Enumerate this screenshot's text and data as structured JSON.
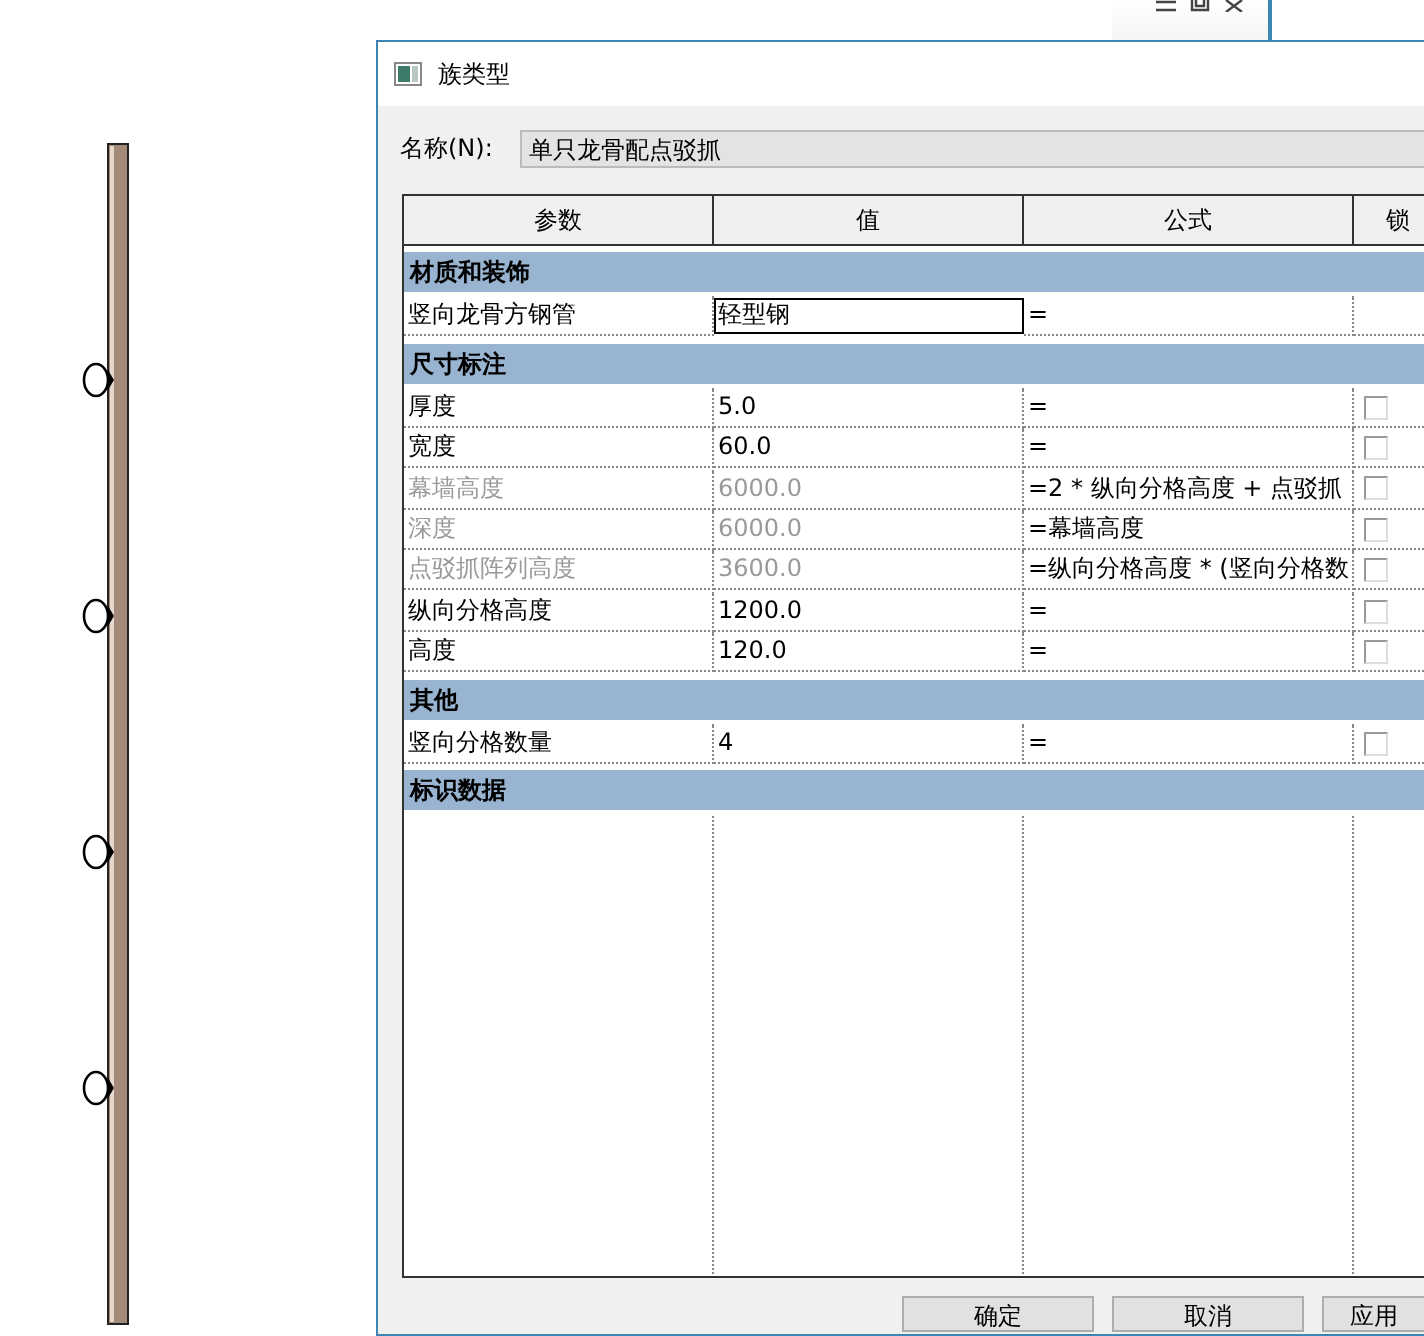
{
  "dialog": {
    "title": "族类型",
    "name_label": "名称(N):",
    "name_value": "单只龙骨配点驳抓"
  },
  "table": {
    "columns": [
      "参数",
      "值",
      "公式",
      "锁"
    ],
    "rows": [
      {
        "kind": "group",
        "label": "材质和装饰"
      },
      {
        "kind": "param",
        "label": "竖向龙骨方钢管",
        "value": "轻型钢",
        "formula": "=",
        "disabled": false,
        "focused": true
      },
      {
        "kind": "group",
        "label": "尺寸标注"
      },
      {
        "kind": "param",
        "label": "厚度",
        "value": "5.0",
        "formula": "=",
        "disabled": false,
        "focused": false,
        "lock": {
          "checked": false
        }
      },
      {
        "kind": "param",
        "label": "宽度",
        "value": "60.0",
        "formula": "=",
        "disabled": false,
        "focused": false,
        "lock": {
          "checked": false
        }
      },
      {
        "kind": "param",
        "label": "幕墙高度",
        "value": "6000.0",
        "formula": "=2 * 纵向分格高度 + 点驳抓",
        "disabled": true,
        "focused": false,
        "lock": {
          "checked": false
        }
      },
      {
        "kind": "param",
        "label": "深度",
        "value": "6000.0",
        "formula": "=幕墙高度",
        "disabled": true,
        "focused": false,
        "lock": {
          "checked": false
        }
      },
      {
        "kind": "param",
        "label": "点驳抓阵列高度",
        "value": "3600.0",
        "formula": "=纵向分格高度 * (竖向分格数",
        "disabled": true,
        "focused": false,
        "lock": {
          "checked": false
        }
      },
      {
        "kind": "param",
        "label": "纵向分格高度",
        "value": "1200.0",
        "formula": "=",
        "disabled": false,
        "focused": false,
        "lock": {
          "checked": false
        }
      },
      {
        "kind": "param",
        "label": "高度",
        "value": "120.0",
        "formula": "=",
        "disabled": false,
        "focused": false,
        "lock": {
          "checked": false
        }
      },
      {
        "kind": "group",
        "label": "其他"
      },
      {
        "kind": "param",
        "label": "竖向分格数量",
        "value": "4",
        "formula": "=",
        "disabled": false,
        "focused": false,
        "lock": {
          "checked": false
        }
      },
      {
        "kind": "group",
        "label": "标识数据"
      }
    ]
  },
  "buttons": [
    "确定",
    "取消",
    "应用"
  ]
}
